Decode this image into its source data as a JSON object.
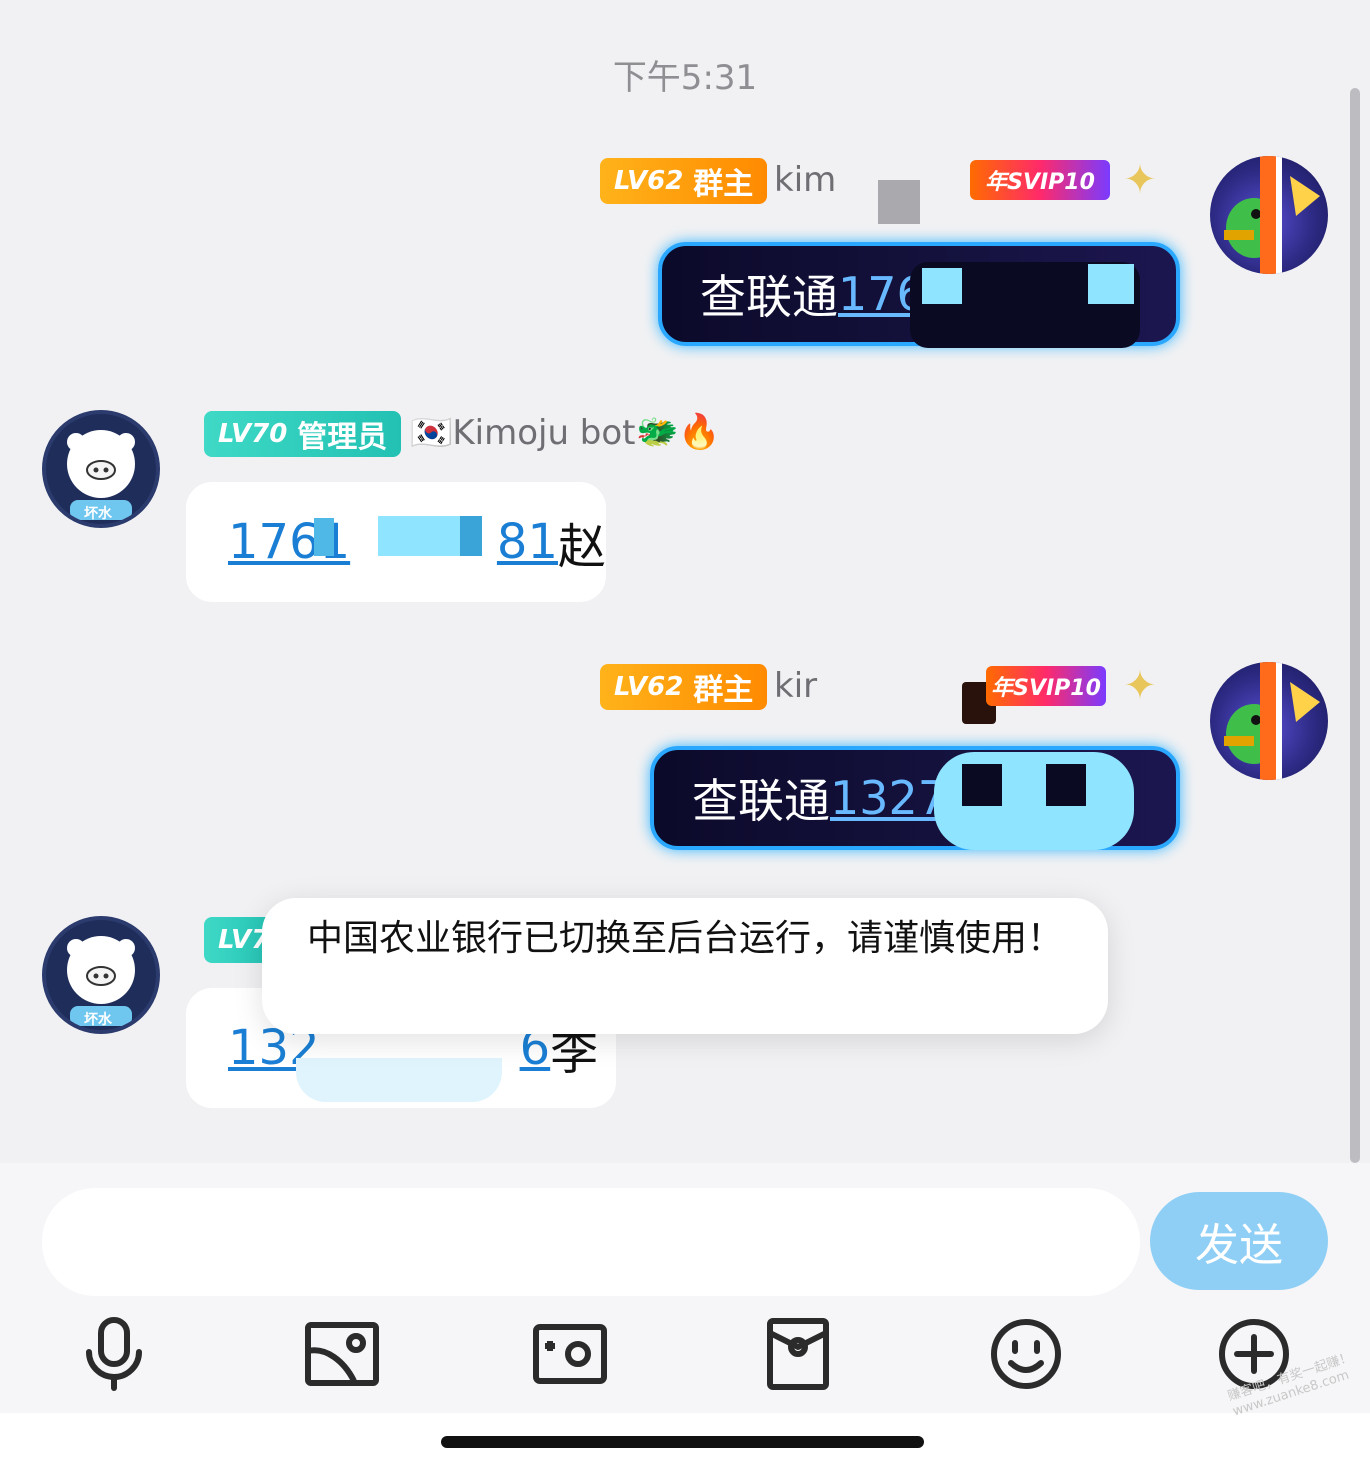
{
  "chat": {
    "timestamp": "下午5:31",
    "messages": [
      {
        "side": "right",
        "badge_level": "LV62",
        "badge_role": "群主",
        "nickname": "kim",
        "vip_badge": "年SVIP10",
        "text_prefix": "查联通",
        "text_number": "176"
      },
      {
        "side": "left",
        "badge_level": "LV70",
        "badge_role": "管理员",
        "nickname": "🇰🇷Kimoju bot",
        "nickname_emojis": "🐲🔥",
        "avatar_label": "坏水",
        "text_number_start": "1761",
        "text_number_end": "81",
        "text_suffix": "赵"
      },
      {
        "side": "right",
        "badge_level": "LV62",
        "badge_role": "群主",
        "nickname": "kir",
        "vip_badge": "年SVIP10",
        "text_prefix": "查联通",
        "text_number": "1327"
      },
      {
        "side": "left",
        "badge_level": "LV7",
        "avatar_label": "坏水",
        "text_number_start": "132",
        "text_number_end": "6",
        "text_suffix": "李"
      }
    ]
  },
  "toast": {
    "message": "中国农业银行已切换至后台运行，请谨慎使用！"
  },
  "composer": {
    "placeholder": "",
    "send_label": "发送"
  },
  "toolbar": {
    "icons": [
      "microphone-icon",
      "image-icon",
      "camera-icon",
      "red-packet-icon",
      "emoji-icon",
      "plus-icon"
    ]
  },
  "watermark": {
    "line1": "赚客吧，有奖一起赚！",
    "line2": "www.zuanke8.com"
  },
  "colors": {
    "owner_badge": "#ff9a0a",
    "admin_badge": "#2fcdbd",
    "link": "#1a7fd4",
    "send_button": "#8fcff6",
    "dark_bubble_glow": "#2aa7ff"
  }
}
